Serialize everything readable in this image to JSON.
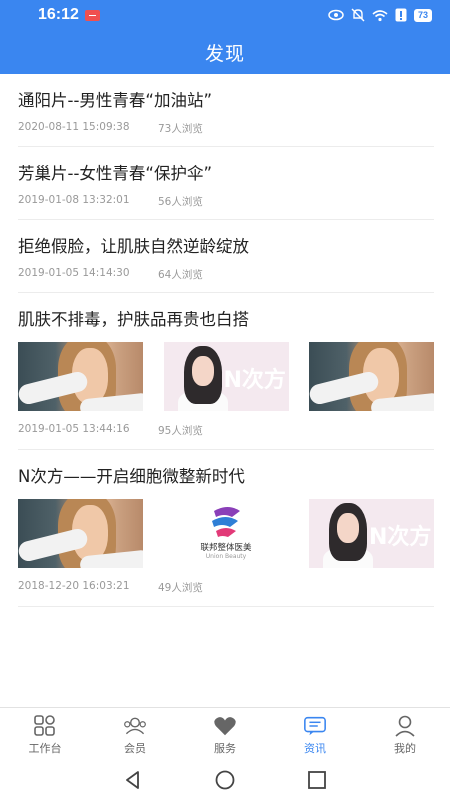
{
  "status_bar": {
    "time": "16:12",
    "battery": "73"
  },
  "header": {
    "title": "发现"
  },
  "articles": [
    {
      "title": "通阳片--男性青春“加油站”",
      "date": "2020-08-11 15:09:38",
      "views": "73人浏览"
    },
    {
      "title": "芳巢片--女性青春“保护伞”",
      "date": "2019-01-08 13:32:01",
      "views": "56人浏览"
    },
    {
      "title": "拒绝假脸，让肌肤自然逆龄绽放",
      "date": "2019-01-05 14:14:30",
      "views": "64人浏览"
    },
    {
      "title": "肌肤不排毒，护肤品再贵也白搭",
      "date": "2019-01-05 13:44:16",
      "views": "95人浏览"
    },
    {
      "title": "N次方——开启细胞微整新时代",
      "date": "2018-12-20 16:03:21",
      "views": "49人浏览"
    }
  ],
  "thumbnails": {
    "brand_logo": "N次方",
    "lianbang_cn": "联邦整体医美",
    "lianbang_en": "Union Beauty"
  },
  "tabs": [
    {
      "label": "工作台",
      "icon": "dashboard-icon"
    },
    {
      "label": "会员",
      "icon": "members-icon"
    },
    {
      "label": "服务",
      "icon": "heart-icon"
    },
    {
      "label": "资讯",
      "icon": "news-icon",
      "active": true
    },
    {
      "label": "我的",
      "icon": "profile-icon"
    }
  ],
  "colors": {
    "primary": "#3a86f0",
    "text": "#222222",
    "meta": "#999999"
  }
}
